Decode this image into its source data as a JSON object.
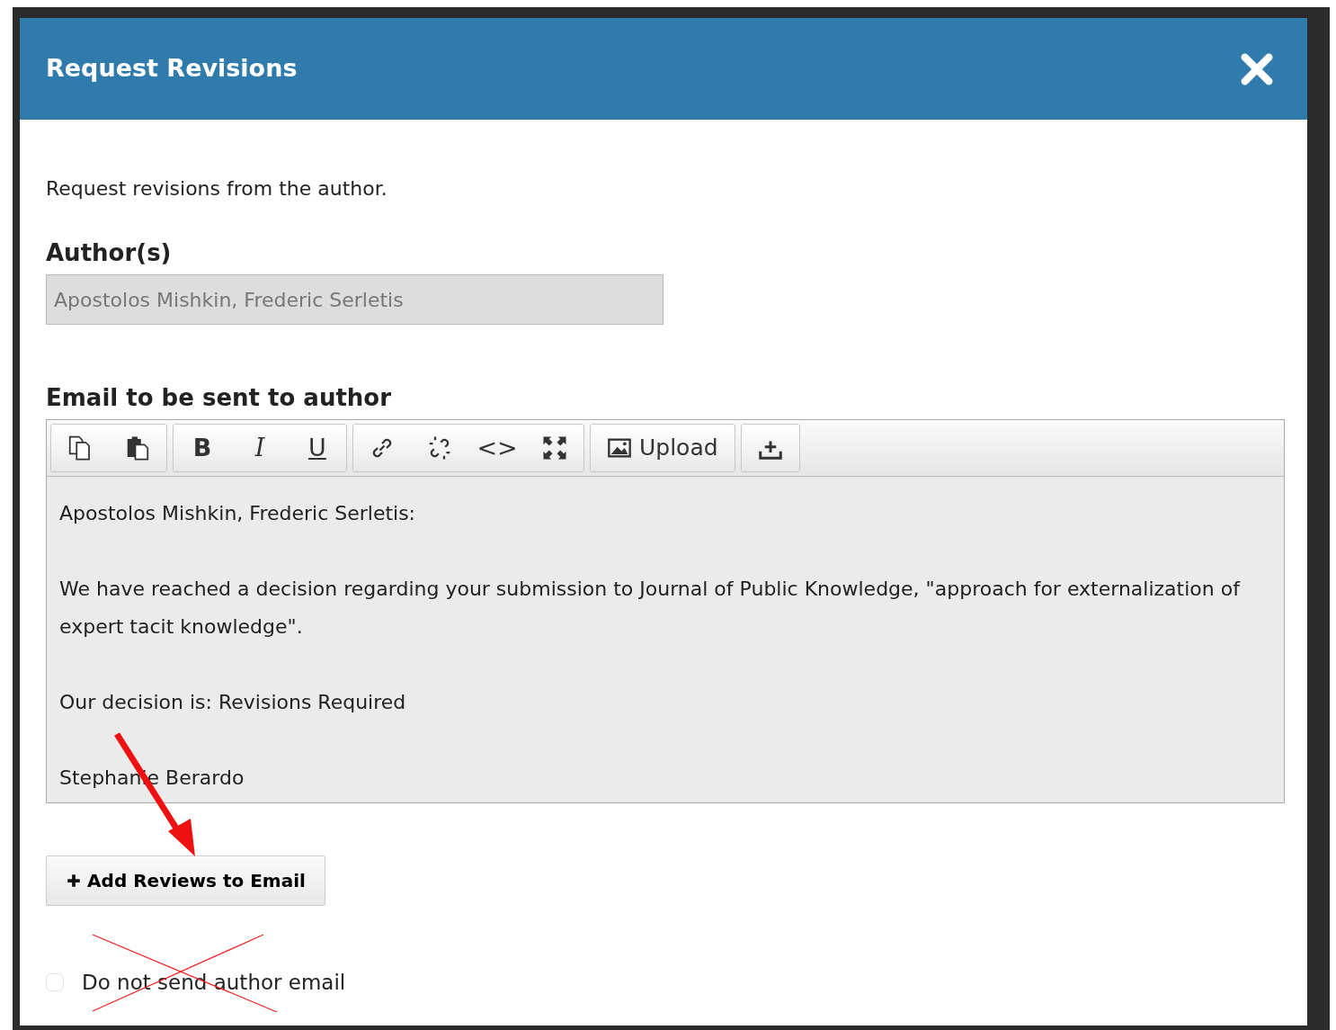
{
  "modal": {
    "title": "Request Revisions"
  },
  "description": "Request revisions from the author.",
  "authors": {
    "label": "Author(s)",
    "value": "Apostolos Mishkin, Frederic Serletis",
    "disabled": true
  },
  "email": {
    "label": "Email to be sent to author",
    "toolbar": [
      [
        {
          "kind": "copy"
        },
        {
          "kind": "paste"
        }
      ],
      [
        {
          "kind": "bold",
          "label": "B"
        },
        {
          "kind": "italic",
          "label": "I"
        },
        {
          "kind": "underline",
          "label": "U"
        }
      ],
      [
        {
          "kind": "link"
        },
        {
          "kind": "unlink"
        },
        {
          "kind": "code",
          "label": "<>"
        },
        {
          "kind": "fullscreen"
        }
      ],
      [
        {
          "kind": "upload",
          "label": "Upload"
        }
      ],
      [
        {
          "kind": "import"
        }
      ]
    ],
    "paragraphs": [
      "Apostolos Mishkin, Frederic Serletis:",
      "We have reached a decision regarding your submission to Journal of Public Knowledge, \"approach for externalization of expert tacit knowledge\".",
      "Our decision is: Revisions Required",
      "Stephanie Berardo"
    ]
  },
  "add_reviews_button": {
    "label": "Add Reviews to Email"
  },
  "do_not_send": {
    "label": "Do not send author email",
    "checked": false
  }
}
